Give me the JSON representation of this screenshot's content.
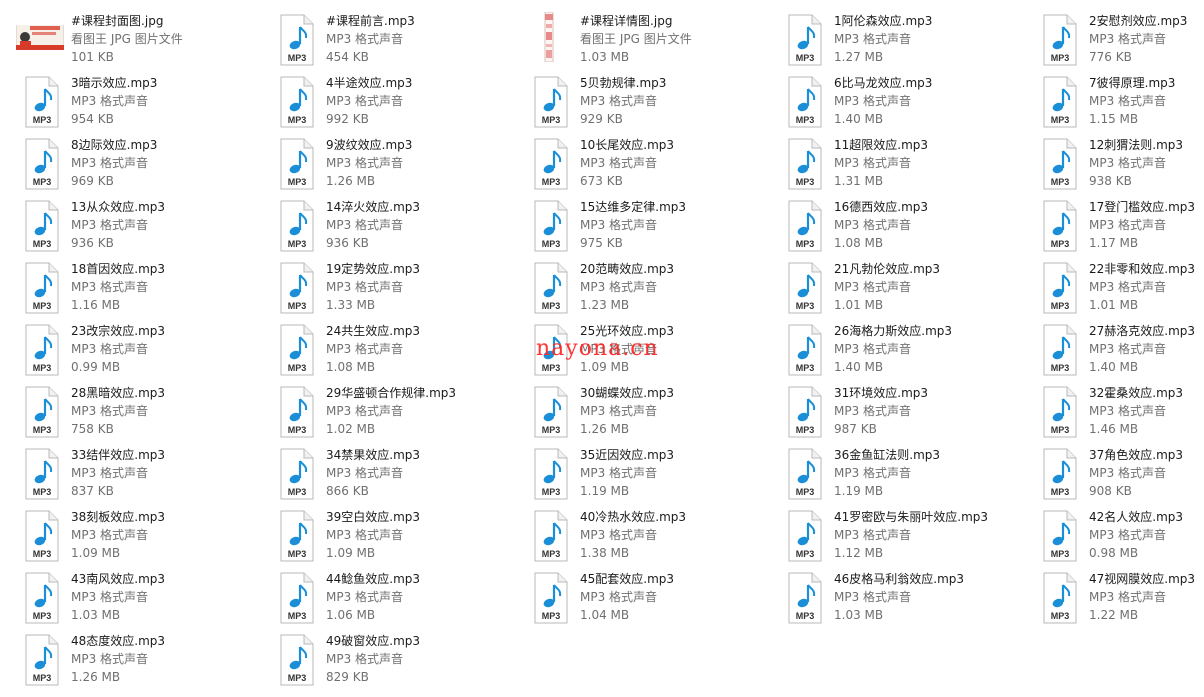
{
  "files": [
    {
      "name": "#课程封面图.jpg",
      "type": "看图王 JPG 图片文件",
      "size": "101 KB",
      "icon": "jpg-cover-thumbnail-icon",
      "kind": "cover"
    },
    {
      "name": "#课程前言.mp3",
      "type": "MP3 格式声音",
      "size": "454 KB",
      "icon": "mp3-icon",
      "kind": "mp3"
    },
    {
      "name": "#课程详情图.jpg",
      "type": "看图王 JPG 图片文件",
      "size": "1.03 MB",
      "icon": "jpg-detail-thumbnail-icon",
      "kind": "detail"
    },
    {
      "name": "1阿伦森效应.mp3",
      "type": "MP3 格式声音",
      "size": "1.27 MB",
      "icon": "mp3-icon",
      "kind": "mp3"
    },
    {
      "name": "2安慰剂效应.mp3",
      "type": "MP3 格式声音",
      "size": "776 KB",
      "icon": "mp3-icon",
      "kind": "mp3"
    },
    {
      "name": "3暗示效应.mp3",
      "type": "MP3 格式声音",
      "size": "954 KB",
      "icon": "mp3-icon",
      "kind": "mp3"
    },
    {
      "name": "4半途效应.mp3",
      "type": "MP3 格式声音",
      "size": "992 KB",
      "icon": "mp3-icon",
      "kind": "mp3"
    },
    {
      "name": "5贝勃规律.mp3",
      "type": "MP3 格式声音",
      "size": "929 KB",
      "icon": "mp3-icon",
      "kind": "mp3"
    },
    {
      "name": "6比马龙效应.mp3",
      "type": "MP3 格式声音",
      "size": "1.40 MB",
      "icon": "mp3-icon",
      "kind": "mp3"
    },
    {
      "name": "7彼得原理.mp3",
      "type": "MP3 格式声音",
      "size": "1.15 MB",
      "icon": "mp3-icon",
      "kind": "mp3"
    },
    {
      "name": "8边际效应.mp3",
      "type": "MP3 格式声音",
      "size": "969 KB",
      "icon": "mp3-icon",
      "kind": "mp3"
    },
    {
      "name": "9波纹效应.mp3",
      "type": "MP3 格式声音",
      "size": "1.26 MB",
      "icon": "mp3-icon",
      "kind": "mp3"
    },
    {
      "name": "10长尾效应.mp3",
      "type": "MP3 格式声音",
      "size": "673 KB",
      "icon": "mp3-icon",
      "kind": "mp3"
    },
    {
      "name": "11超限效应.mp3",
      "type": "MP3 格式声音",
      "size": "1.31 MB",
      "icon": "mp3-icon",
      "kind": "mp3"
    },
    {
      "name": "12刺猬法则.mp3",
      "type": "MP3 格式声音",
      "size": "938 KB",
      "icon": "mp3-icon",
      "kind": "mp3"
    },
    {
      "name": "13从众效应.mp3",
      "type": "MP3 格式声音",
      "size": "936 KB",
      "icon": "mp3-icon",
      "kind": "mp3"
    },
    {
      "name": "14淬火效应.mp3",
      "type": "MP3 格式声音",
      "size": "936 KB",
      "icon": "mp3-icon",
      "kind": "mp3"
    },
    {
      "name": "15达维多定律.mp3",
      "type": "MP3 格式声音",
      "size": "975 KB",
      "icon": "mp3-icon",
      "kind": "mp3"
    },
    {
      "name": "16德西效应.mp3",
      "type": "MP3 格式声音",
      "size": "1.08 MB",
      "icon": "mp3-icon",
      "kind": "mp3"
    },
    {
      "name": "17登门槛效应.mp3",
      "type": "MP3 格式声音",
      "size": "1.17 MB",
      "icon": "mp3-icon",
      "kind": "mp3"
    },
    {
      "name": "18首因效应.mp3",
      "type": "MP3 格式声音",
      "size": "1.16 MB",
      "icon": "mp3-icon",
      "kind": "mp3"
    },
    {
      "name": "19定势效应.mp3",
      "type": "MP3 格式声音",
      "size": "1.33 MB",
      "icon": "mp3-icon",
      "kind": "mp3"
    },
    {
      "name": "20范畴效应.mp3",
      "type": "MP3 格式声音",
      "size": "1.23 MB",
      "icon": "mp3-icon",
      "kind": "mp3"
    },
    {
      "name": "21凡勃伦效应.mp3",
      "type": "MP3 格式声音",
      "size": "1.01 MB",
      "icon": "mp3-icon",
      "kind": "mp3"
    },
    {
      "name": "22非零和效应.mp3",
      "type": "MP3 格式声音",
      "size": "1.01 MB",
      "icon": "mp3-icon",
      "kind": "mp3"
    },
    {
      "name": "23改宗效应.mp3",
      "type": "MP3 格式声音",
      "size": "0.99 MB",
      "icon": "mp3-icon",
      "kind": "mp3"
    },
    {
      "name": "24共生效应.mp3",
      "type": "MP3 格式声音",
      "size": "1.08 MB",
      "icon": "mp3-icon",
      "kind": "mp3"
    },
    {
      "name": "25光环效应.mp3",
      "type": "MP3 格式声音",
      "size": "1.09 MB",
      "icon": "mp3-icon",
      "kind": "mp3"
    },
    {
      "name": "26海格力斯效应.mp3",
      "type": "MP3 格式声音",
      "size": "1.40 MB",
      "icon": "mp3-icon",
      "kind": "mp3"
    },
    {
      "name": "27赫洛克效应.mp3",
      "type": "MP3 格式声音",
      "size": "1.40 MB",
      "icon": "mp3-icon",
      "kind": "mp3"
    },
    {
      "name": "28黑暗效应.mp3",
      "type": "MP3 格式声音",
      "size": "758 KB",
      "icon": "mp3-icon",
      "kind": "mp3"
    },
    {
      "name": "29华盛顿合作规律.mp3",
      "type": "MP3 格式声音",
      "size": "1.02 MB",
      "icon": "mp3-icon",
      "kind": "mp3"
    },
    {
      "name": "30蝴蝶效应.mp3",
      "type": "MP3 格式声音",
      "size": "1.26 MB",
      "icon": "mp3-icon",
      "kind": "mp3"
    },
    {
      "name": "31环境效应.mp3",
      "type": "MP3 格式声音",
      "size": "987 KB",
      "icon": "mp3-icon",
      "kind": "mp3"
    },
    {
      "name": "32霍桑效应.mp3",
      "type": "MP3 格式声音",
      "size": "1.46 MB",
      "icon": "mp3-icon",
      "kind": "mp3"
    },
    {
      "name": "33结伴效应.mp3",
      "type": "MP3 格式声音",
      "size": "837 KB",
      "icon": "mp3-icon",
      "kind": "mp3"
    },
    {
      "name": "34禁果效应.mp3",
      "type": "MP3 格式声音",
      "size": "866 KB",
      "icon": "mp3-icon",
      "kind": "mp3"
    },
    {
      "name": "35近因效应.mp3",
      "type": "MP3 格式声音",
      "size": "1.19 MB",
      "icon": "mp3-icon",
      "kind": "mp3"
    },
    {
      "name": "36金鱼缸法则.mp3",
      "type": "MP3 格式声音",
      "size": "1.19 MB",
      "icon": "mp3-icon",
      "kind": "mp3"
    },
    {
      "name": "37角色效应.mp3",
      "type": "MP3 格式声音",
      "size": "908 KB",
      "icon": "mp3-icon",
      "kind": "mp3"
    },
    {
      "name": "38刻板效应.mp3",
      "type": "MP3 格式声音",
      "size": "1.09 MB",
      "icon": "mp3-icon",
      "kind": "mp3"
    },
    {
      "name": "39空白效应.mp3",
      "type": "MP3 格式声音",
      "size": "1.09 MB",
      "icon": "mp3-icon",
      "kind": "mp3"
    },
    {
      "name": "40冷热水效应.mp3",
      "type": "MP3 格式声音",
      "size": "1.38 MB",
      "icon": "mp3-icon",
      "kind": "mp3"
    },
    {
      "name": "41罗密欧与朱丽叶效应.mp3",
      "type": "MP3 格式声音",
      "size": "1.12 MB",
      "icon": "mp3-icon",
      "kind": "mp3"
    },
    {
      "name": "42名人效应.mp3",
      "type": "MP3 格式声音",
      "size": "0.98 MB",
      "icon": "mp3-icon",
      "kind": "mp3"
    },
    {
      "name": "43南风效应.mp3",
      "type": "MP3 格式声音",
      "size": "1.03 MB",
      "icon": "mp3-icon",
      "kind": "mp3"
    },
    {
      "name": "44鲶鱼效应.mp3",
      "type": "MP3 格式声音",
      "size": "1.06 MB",
      "icon": "mp3-icon",
      "kind": "mp3"
    },
    {
      "name": "45配套效应.mp3",
      "type": "MP3 格式声音",
      "size": "1.04 MB",
      "icon": "mp3-icon",
      "kind": "mp3"
    },
    {
      "name": "46皮格马利翁效应.mp3",
      "type": "MP3 格式声音",
      "size": "1.03 MB",
      "icon": "mp3-icon",
      "kind": "mp3"
    },
    {
      "name": "47视网膜效应.mp3",
      "type": "MP3 格式声音",
      "size": "1.22 MB",
      "icon": "mp3-icon",
      "kind": "mp3"
    },
    {
      "name": "48态度效应.mp3",
      "type": "MP3 格式声音",
      "size": "1.26 MB",
      "icon": "mp3-icon",
      "kind": "mp3"
    },
    {
      "name": "49破窗效应.mp3",
      "type": "MP3 格式声音",
      "size": "829 KB",
      "icon": "mp3-icon",
      "kind": "mp3"
    }
  ],
  "watermark": "nayona.cn",
  "colors": {
    "mp3_note": "#1a8fd8",
    "mp3_label": "#333333",
    "cover_red": "#d93b2b",
    "detail_pink": "#e98a8a"
  }
}
